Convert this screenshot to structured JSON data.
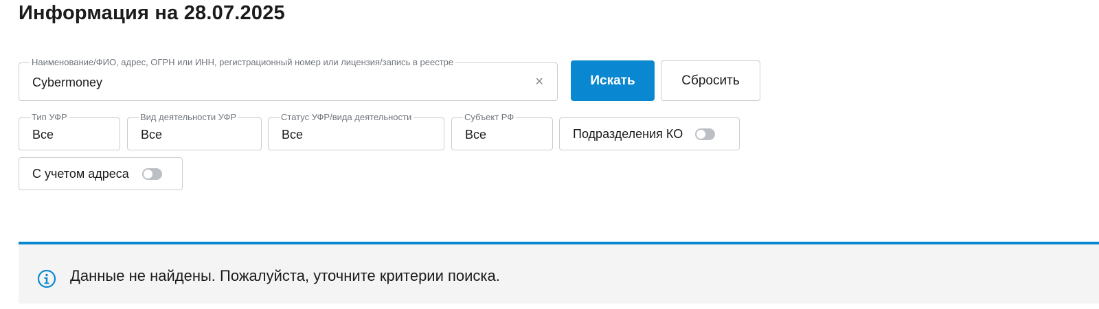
{
  "header": {
    "title": "Информация на 28.07.2025"
  },
  "search": {
    "label": "Наименование/ФИО, адрес, ОГРН или ИНН, регистрационный номер или лицензия/запись в реестре",
    "value": "Cybermoney",
    "clear_symbol": "×"
  },
  "buttons": {
    "search_label": "Искать",
    "reset_label": "Сбросить"
  },
  "filters": {
    "type": {
      "label": "Тип УФР",
      "value": "Все"
    },
    "activity": {
      "label": "Вид деятельности УФР",
      "value": "Все"
    },
    "status": {
      "label": "Статус УФР/вида деятельности",
      "value": "Все"
    },
    "subject": {
      "label": "Субъект РФ",
      "value": "Все"
    }
  },
  "toggles": {
    "ko_divisions": {
      "label": "Подразделения КО",
      "on": false
    },
    "with_address": {
      "label": "С учетом адреса",
      "on": false
    }
  },
  "notice": {
    "icon": "info-icon",
    "text": "Данные не найдены. Пожалуйста, уточните критерии поиска."
  },
  "colors": {
    "accent": "#0a87d1",
    "notice_bg": "#f4f4f4",
    "border": "#c9ccd1"
  }
}
